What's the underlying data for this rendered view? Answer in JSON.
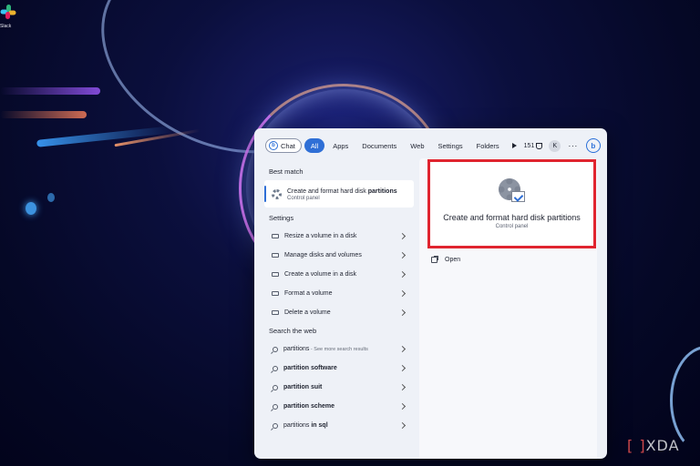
{
  "desktop": {
    "icons": [
      {
        "label": "Slack",
        "icon": "slack-icon"
      }
    ],
    "watermark": "XDA"
  },
  "search": {
    "tabs": [
      {
        "label": "Chat",
        "icon": "bing-chat-icon"
      },
      {
        "label": "All",
        "active": true
      },
      {
        "label": "Apps"
      },
      {
        "label": "Documents"
      },
      {
        "label": "Web"
      },
      {
        "label": "Settings"
      },
      {
        "label": "Folders"
      }
    ],
    "points": "151",
    "avatar_initial": "K",
    "more_label": "···",
    "accent": "#2f6fd6",
    "highlight_color": "#e0242f"
  },
  "best_match": {
    "heading": "Best match",
    "title_plain": "Create and format hard disk ",
    "title_bold": "partitions",
    "subtitle": "Control panel"
  },
  "settings": {
    "heading": "Settings",
    "items": [
      {
        "label": "Resize a volume in a disk"
      },
      {
        "label": "Manage disks and volumes"
      },
      {
        "label": "Create a volume in a disk"
      },
      {
        "label": "Format a volume"
      },
      {
        "label": "Delete a volume"
      }
    ]
  },
  "web": {
    "heading": "Search the web",
    "items": [
      {
        "plain": "partitions",
        "bold": "",
        "hint": " - See more search results"
      },
      {
        "plain": "",
        "bold": "partition software",
        "hint": ""
      },
      {
        "plain": "",
        "bold": "partition suit",
        "hint": ""
      },
      {
        "plain": "",
        "bold": "partition scheme",
        "hint": ""
      },
      {
        "plain": "partitions ",
        "bold": "in sql",
        "hint": ""
      }
    ]
  },
  "preview": {
    "title": "Create and format hard disk partitions",
    "subtitle": "Control panel",
    "actions": [
      {
        "label": "Open",
        "icon": "open-external-icon"
      }
    ]
  }
}
